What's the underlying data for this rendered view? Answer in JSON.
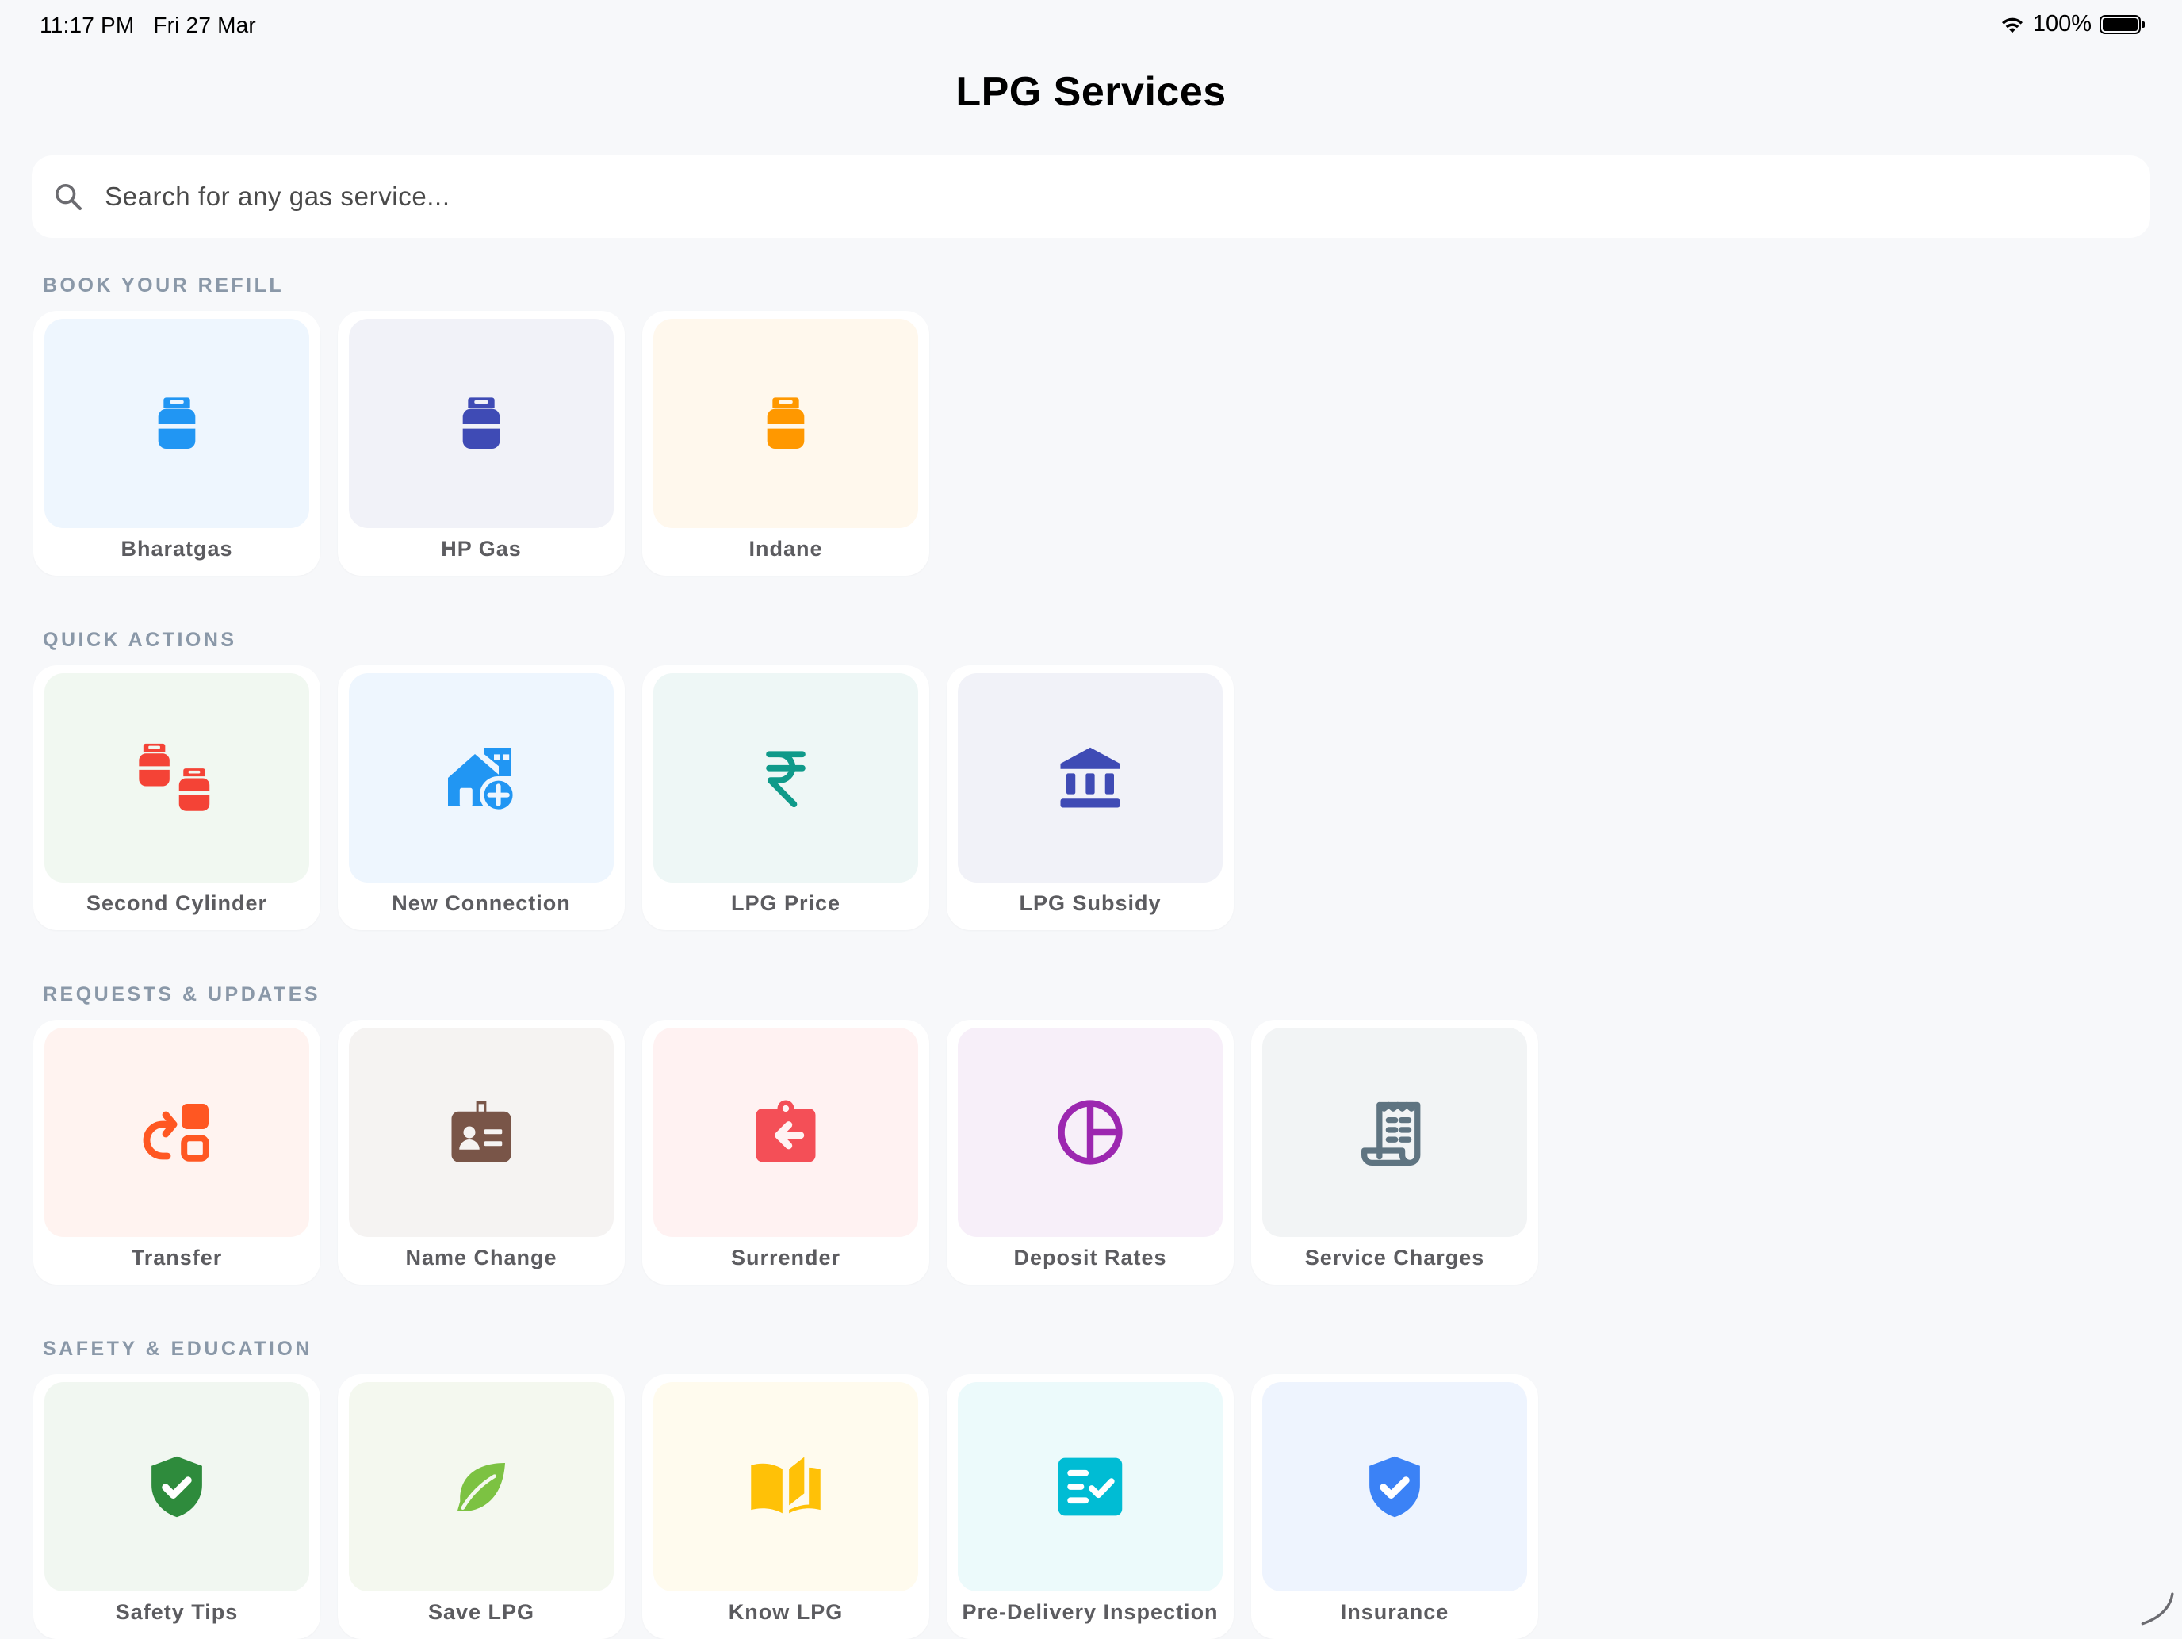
{
  "status_bar": {
    "time": "11:17 PM",
    "date": "Fri 27 Mar",
    "battery": "100%"
  },
  "header": {
    "title": "LPG Services"
  },
  "search": {
    "placeholder": "Search for any gas service..."
  },
  "sections": {
    "book_refill": {
      "title": "BOOK YOUR REFILL",
      "items": [
        {
          "label": "Bharatgas",
          "icon": "gas-cylinder-icon",
          "color": "#2196f3",
          "bg": "#eef6fe"
        },
        {
          "label": "HP Gas",
          "icon": "gas-cylinder-icon",
          "color": "#3f4bb5",
          "bg": "#f1f2f8"
        },
        {
          "label": "Indane",
          "icon": "gas-cylinder-icon",
          "color": "#ff9800",
          "bg": "#fff8ed"
        }
      ]
    },
    "quick_actions": {
      "title": "QUICK ACTIONS",
      "items": [
        {
          "label": "Second Cylinder",
          "icon": "two-cylinders-icon",
          "color": "#f44336",
          "bg": "#f1f8f1"
        },
        {
          "label": "New Connection",
          "icon": "home-add-icon",
          "color": "#2196f3",
          "bg": "#eef6fe"
        },
        {
          "label": "LPG Price",
          "icon": "rupee-icon",
          "color": "#0f9a8a",
          "bg": "#eef7f6"
        },
        {
          "label": "LPG Subsidy",
          "icon": "bank-icon",
          "color": "#3f4bb5",
          "bg": "#f1f2f8"
        }
      ]
    },
    "requests_updates": {
      "title": "REQUESTS & UPDATES",
      "items": [
        {
          "label": "Transfer",
          "icon": "transfer-icon",
          "color": "#ff5722",
          "bg": "#fff3f0"
        },
        {
          "label": "Name Change",
          "icon": "id-badge-icon",
          "color": "#795548",
          "bg": "#f5f3f2"
        },
        {
          "label": "Surrender",
          "icon": "surrender-icon",
          "color": "#f44f57",
          "bg": "#fff2f2"
        },
        {
          "label": "Deposit Rates",
          "icon": "pie-chart-icon",
          "color": "#9c27b0",
          "bg": "#f7eff9"
        },
        {
          "label": "Service Charges",
          "icon": "receipt-icon",
          "color": "#5f7481",
          "bg": "#f2f4f5"
        }
      ]
    },
    "safety_education": {
      "title": "SAFETY & EDUCATION",
      "items": [
        {
          "label": "Safety Tips",
          "icon": "shield-check-icon",
          "color": "#2e8b3c",
          "bg": "#f1f7f1"
        },
        {
          "label": "Save LPG",
          "icon": "leaf-icon",
          "color": "#7cc242",
          "bg": "#f4f8ef"
        },
        {
          "label": "Know LPG",
          "icon": "book-icon",
          "color": "#ffc107",
          "bg": "#fffbee"
        },
        {
          "label": "Pre-Delivery Inspection",
          "icon": "checklist-icon",
          "color": "#00bcd4",
          "bg": "#ecfafb"
        },
        {
          "label": "Insurance",
          "icon": "shield-check-icon",
          "color": "#3b82f6",
          "bg": "#eef4fe"
        }
      ]
    }
  }
}
